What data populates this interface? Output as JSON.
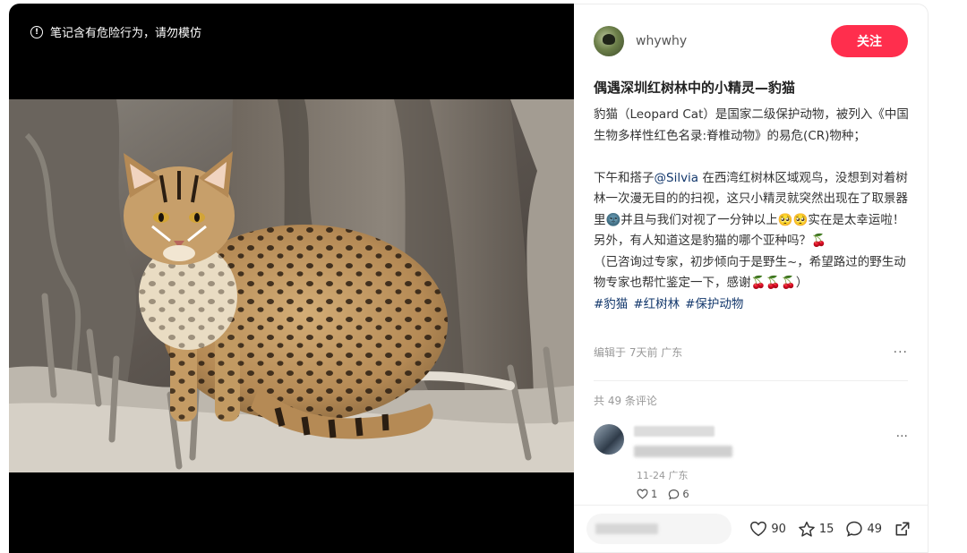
{
  "media": {
    "warning": "笔记含有危险行为，请勿模仿"
  },
  "author": {
    "name": "whywhy",
    "follow_label": "关注"
  },
  "post": {
    "title": "偶遇深圳红树林中的小精灵—豹猫",
    "para1": "豹猫（Leopard Cat）是国家二级保护动物，被列入《中国生物多样性红色名录:脊椎动物》的易危(CR)物种；",
    "para2_before": "下午和搭子",
    "para2_mention": "@Silvia",
    "para2_after": " 在西湾红树林区域观鸟，没想到对着树林一次漫无目的的扫视，这只小精灵就突然出现在了取景器里🌚并且与我们对视了一分钟以上🥺🥺实在是太幸运啦！",
    "para3": "另外，有人知道这是豹猫的哪个亚种吗？🍒",
    "para4": "（已咨询过专家，初步倾向于是野生~，希望路过的野生动物专家也帮忙鉴定一下，感谢🍒🍒🍒）",
    "tags": [
      "#豹猫",
      "#红树林",
      "#保护动物"
    ],
    "meta": "编辑于 7天前 广东",
    "more": "···"
  },
  "comments": {
    "count_label": "共 49 条评论",
    "items": [
      {
        "date": "11-24 广东",
        "likes": "1",
        "replies": "6",
        "more": "···"
      }
    ]
  },
  "stats": {
    "likes": "90",
    "collects": "15",
    "comments": "49"
  },
  "icons": {
    "warning": "info-circle-icon",
    "like": "heart-icon",
    "collect": "star-icon",
    "comment": "chat-bubble-icon",
    "share": "share-icon"
  },
  "colors": {
    "accent": "#ff2e4d",
    "link": "#13386c"
  }
}
